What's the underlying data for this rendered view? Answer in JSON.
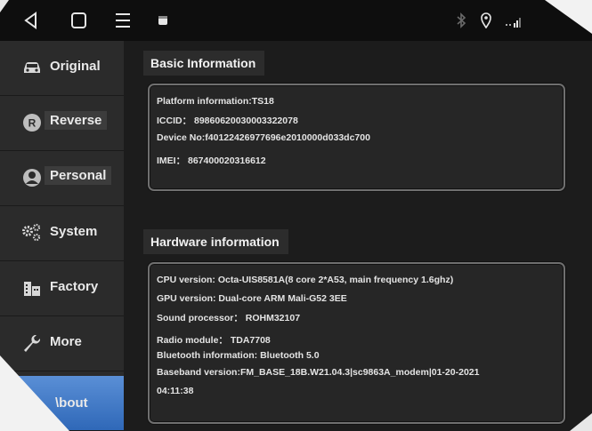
{
  "statusbar": {
    "back_icon": "back-triangle-icon",
    "home_icon": "home-square-icon",
    "menu_icon": "menu-lines-icon",
    "app_icon": "notification-app-icon",
    "bluetooth_icon": "bluetooth-icon",
    "location_icon": "location-pin-icon",
    "signal_icon": "signal-bars-icon"
  },
  "sidebar": {
    "items": [
      {
        "label": "Original",
        "icon": "car-icon"
      },
      {
        "label": "Reverse",
        "icon": "reverse-r-icon"
      },
      {
        "label": "Personal",
        "icon": "person-icon"
      },
      {
        "label": "System",
        "icon": "gears-icon"
      },
      {
        "label": "Factory",
        "icon": "factory-icon"
      },
      {
        "label": "More",
        "icon": "wrench-icon"
      },
      {
        "label": "\\bout",
        "icon": ""
      }
    ],
    "active_index": 6
  },
  "basic": {
    "title": "Basic Information",
    "platform": "Platform information:TS18",
    "iccid": "ICCID： 89860620030003322078",
    "device": "Device No:f40122426977696e2010000d033dc700",
    "imei": "IMEI： 867400020316612"
  },
  "hardware": {
    "title": "Hardware information",
    "cpu": "CPU version: Octa-UIS8581A(8 core 2*A53, main frequency 1.6ghz)",
    "gpu": "GPU version: Dual-core ARM Mali-G52 3EE",
    "sound": "Sound processor： ROHM32107",
    "radio": "Radio module： TDA7708",
    "bluetooth": "Bluetooth information: Bluetooth 5.0",
    "baseband_line1": "Baseband version:FM_BASE_18B.W21.04.3|sc9863A_modem|01-20-2021",
    "baseband_line2": "04:11:38"
  },
  "colors": {
    "accent": "#3a74c4",
    "background": "#1c1c1c",
    "sidebar": "#2b2b2b"
  }
}
